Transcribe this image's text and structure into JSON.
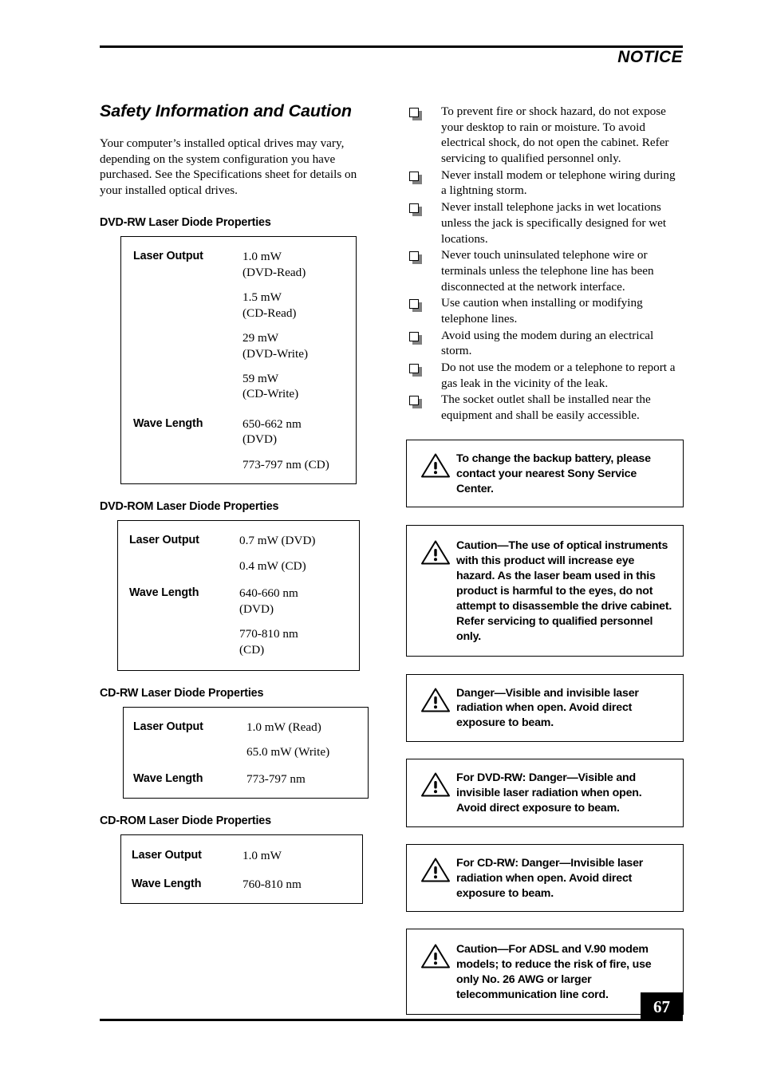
{
  "header": {
    "title": "NOTICE"
  },
  "left": {
    "section_title": "Safety Information and Caution",
    "intro": "Your computer’s installed optical drives may vary, depending on the system configuration you have purchased. See the Specifications sheet for details on your installed optical drives.",
    "tables": [
      {
        "heading": "DVD-RW Laser Diode Properties",
        "rows": [
          {
            "label": "Laser Output",
            "values": [
              "1.0 mW\n(DVD-Read)",
              "1.5 mW\n(CD-Read)",
              "29 mW\n(DVD-Write)",
              "59 mW\n(CD-Write)"
            ]
          },
          {
            "label": "Wave Length",
            "values": [
              "650-662 nm\n(DVD)",
              "773-797 nm (CD)"
            ]
          }
        ]
      },
      {
        "heading": "DVD-ROM Laser Diode Properties",
        "rows": [
          {
            "label": "Laser Output",
            "values": [
              "0.7 mW (DVD)",
              "0.4 mW (CD)"
            ]
          },
          {
            "label": "Wave Length",
            "values": [
              "640-660 nm\n(DVD)",
              "770-810 nm\n(CD)"
            ]
          }
        ]
      },
      {
        "heading": "CD-RW Laser Diode Properties",
        "rows": [
          {
            "label": "Laser Output",
            "values": [
              "1.0 mW (Read)",
              "65.0 mW (Write)"
            ]
          },
          {
            "label": "Wave Length",
            "values": [
              "773-797 nm"
            ]
          }
        ]
      },
      {
        "heading": "CD-ROM Laser Diode Properties",
        "rows": [
          {
            "label": "Laser Output",
            "values": [
              "1.0 mW"
            ]
          },
          {
            "label": "Wave Length",
            "values": [
              "760-810 nm"
            ]
          }
        ]
      }
    ]
  },
  "right": {
    "bullet_icon": "checkbox-square-icon",
    "notices": [
      "To prevent fire or shock hazard, do not expose your desktop to rain or moisture. To avoid electrical shock, do not open the cabinet. Refer servicing to qualified personnel only.",
      "Never install modem or telephone wiring during a lightning storm.",
      "Never install telephone jacks in wet locations unless the jack is specifically designed for wet locations.",
      "Never touch uninsulated telephone wire or terminals unless the telephone line has been disconnected at the network interface.",
      "Use caution when installing or modifying telephone lines.",
      "Avoid using the modem during an electrical storm.",
      "Do not use the modem or a telephone to report a gas leak in the vicinity of the leak.",
      "The socket outlet shall be installed near the equipment and shall be easily accessible."
    ],
    "warning_icon": "warning-triangle-icon",
    "warnings": [
      "To change the backup battery, please contact your nearest Sony Service Center.",
      "Caution—The use of optical instruments with this product will increase eye hazard. As the laser beam used in this product is harmful to the eyes, do not attempt to disassemble the drive cabinet. Refer servicing to qualified personnel only.",
      "Danger—Visible and invisible laser radiation when open. Avoid direct exposure to beam.",
      "For DVD-RW: Danger—Visible and invisible laser radiation when open. Avoid direct exposure to beam.",
      "For CD-RW: Danger—Invisible laser radiation when open. Avoid direct exposure to beam.",
      "Caution—For ADSL and V.90 modem models; to reduce the risk of fire, use only No. 26 AWG or larger telecommunication line cord."
    ]
  },
  "footer": {
    "page_number": "67"
  }
}
